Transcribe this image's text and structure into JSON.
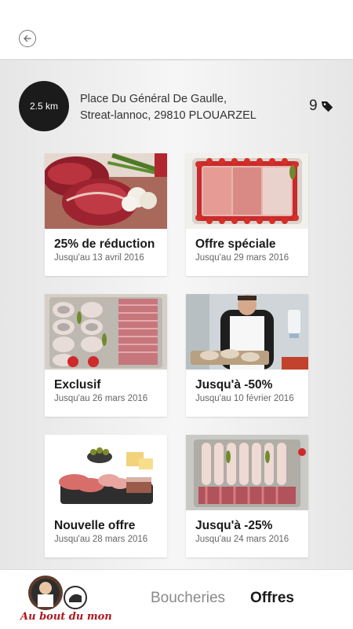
{
  "header": {
    "back_icon": "arrow-left-circle-icon"
  },
  "shop": {
    "distance": "2.5 km",
    "address_line1": "Place Du Général De Gaulle,",
    "address_line2": "Streat-lannoc, 29810 PLOUARZEL",
    "offer_count": "9",
    "offer_icon": "price-tag-icon"
  },
  "offers": [
    {
      "title": "25% de réduction",
      "date": "Jusqu'au 13 avril 2016",
      "image": "beef-steak-photo"
    },
    {
      "title": "Offre spéciale",
      "date": "Jusqu'au 29 mars 2016",
      "image": "ham-platter-photo"
    },
    {
      "title": "Exclusif",
      "date": "Jusqu'au 26 mars 2016",
      "image": "sausage-platter-photo"
    },
    {
      "title": "Jusqu'à -50%",
      "date": "Jusqu'au 10 février 2016",
      "image": "butcher-photo"
    },
    {
      "title": "Nouvelle offre",
      "date": "Jusqu'au 28 mars 2016",
      "image": "charcuterie-photo"
    },
    {
      "title": "Jusqu'à -25%",
      "date": "Jusqu'au 24 mars 2016",
      "image": "rolled-ham-photo"
    }
  ],
  "footer": {
    "logo_text": "Au bout du monde",
    "tabs": [
      {
        "label": "Boucheries",
        "active": false
      },
      {
        "label": "Offres",
        "active": true
      }
    ]
  },
  "colors": {
    "accent": "#1b1b1b",
    "inactive_tab": "#8a8a8a",
    "logo_red": "#b0171d"
  }
}
